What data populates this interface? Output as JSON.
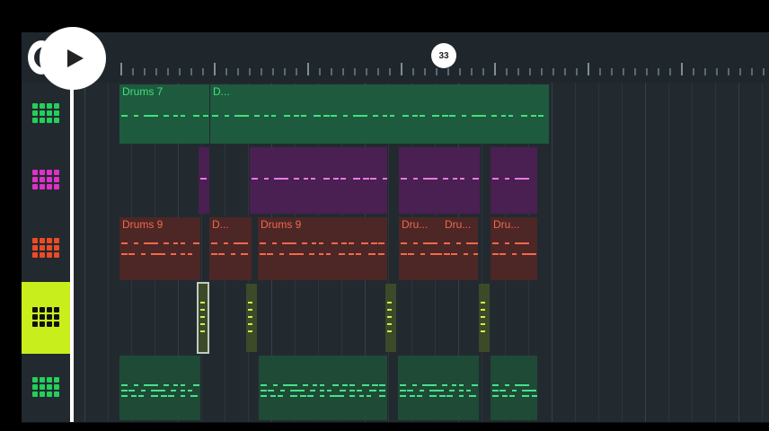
{
  "transport": {
    "play_icon": "play-icon",
    "playhead_position": "33"
  },
  "tracks": [
    {
      "name": "track-1",
      "color": "#22d05a",
      "clip_bg": "#1e5a3e",
      "label_color": "#3ee27a",
      "clips": [
        {
          "label": "Drums 7"
        },
        {
          "label": "D..."
        }
      ]
    },
    {
      "name": "track-2",
      "color": "#e030c8",
      "clip_bg": "#4a1f52",
      "label_color": "#e67ae0",
      "clips": [
        {
          "label": ""
        },
        {
          "label": ""
        },
        {
          "label": ""
        },
        {
          "label": ""
        }
      ]
    },
    {
      "name": "track-3",
      "color": "#f04a24",
      "clip_bg": "#4d2626",
      "label_color": "#f06a4a",
      "clips": [
        {
          "label": "Drums 9"
        },
        {
          "label": "D..."
        },
        {
          "label": "Drums 9"
        },
        {
          "label": "Dru..."
        },
        {
          "label": "Dru..."
        },
        {
          "label": "Dru..."
        }
      ]
    },
    {
      "name": "track-4",
      "color": "#111111",
      "clip_bg": "#3c4a2a",
      "label_color": "#d8e84a",
      "selected": true,
      "clips": [
        {
          "label": ""
        },
        {
          "label": ""
        },
        {
          "label": ""
        },
        {
          "label": ""
        }
      ]
    },
    {
      "name": "track-5",
      "color": "#22d05a",
      "clip_bg": "#1e4a36",
      "label_color": "#49e08a",
      "clips": [
        {
          "label": ""
        },
        {
          "label": ""
        },
        {
          "label": ""
        },
        {
          "label": ""
        }
      ]
    }
  ]
}
